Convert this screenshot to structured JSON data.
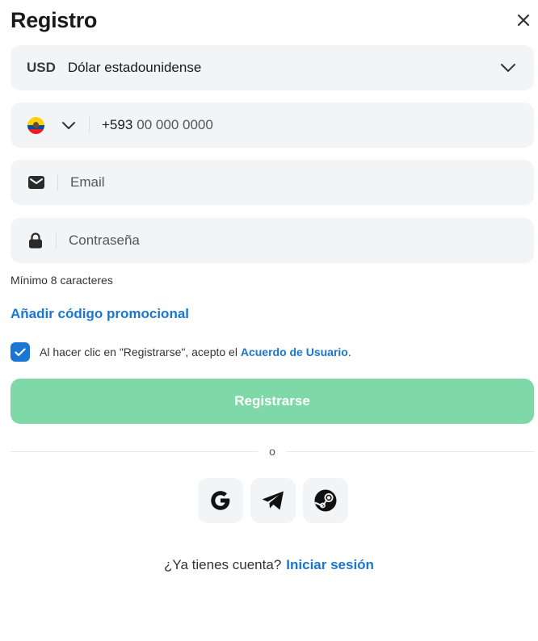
{
  "header": {
    "title": "Registro"
  },
  "currency": {
    "code": "USD",
    "name": "Dólar estadounidense"
  },
  "phone": {
    "prefix": "+593",
    "placeholder": "00 000 0000"
  },
  "email": {
    "placeholder": "Email"
  },
  "password": {
    "placeholder": "Contraseña",
    "hint": "Mínimo 8 caracteres"
  },
  "promo": {
    "label": "Añadir código promocional"
  },
  "agreement": {
    "checked": true,
    "text_before": "Al hacer clic en \"Registrarse\", acepto el ",
    "link": "Acuerdo de Usuario",
    "text_after": "."
  },
  "register": {
    "label": "Registrarse"
  },
  "divider": {
    "label": "o"
  },
  "social": [
    "google-icon",
    "telegram-icon",
    "steam-icon"
  ],
  "login": {
    "prompt": "¿Ya tienes cuenta?",
    "link": "Iniciar sesión"
  },
  "colors": {
    "accent": "#1a76d2",
    "button": "#7fd8a8",
    "field_bg": "#f3f4f5"
  }
}
